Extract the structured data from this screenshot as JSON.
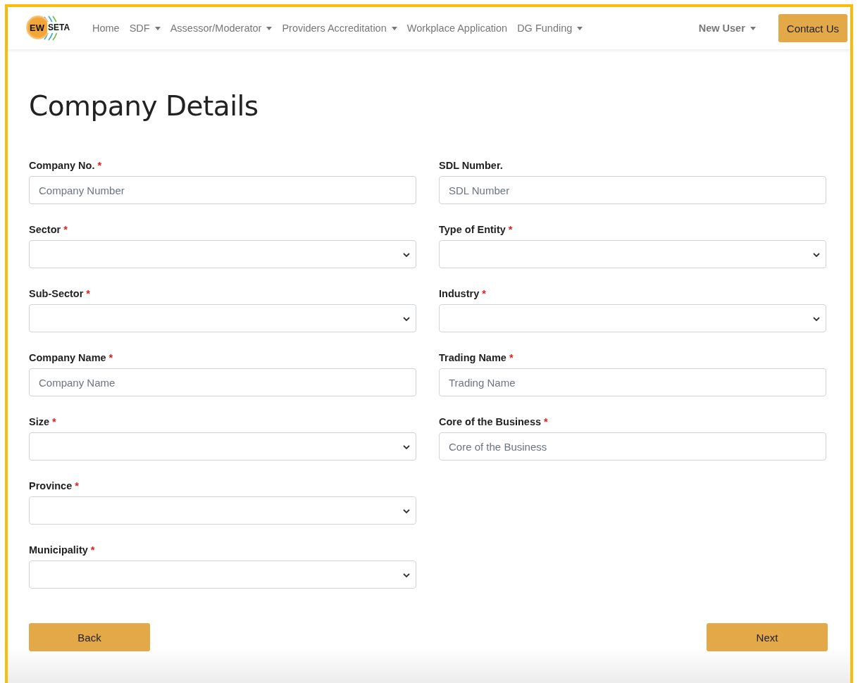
{
  "logo": {
    "left": "EW",
    "right": "SETA"
  },
  "nav": {
    "items": [
      {
        "label": "Home",
        "dropdown": false
      },
      {
        "label": "SDF",
        "dropdown": true
      },
      {
        "label": "Assessor/Moderator",
        "dropdown": true
      },
      {
        "label": "Providers Accreditation",
        "dropdown": true
      },
      {
        "label": "Workplace Application",
        "dropdown": false
      },
      {
        "label": "DG Funding",
        "dropdown": true
      }
    ],
    "user": {
      "label": "New User",
      "dropdown": true
    },
    "contact_button": "Contact Us"
  },
  "title": "Company Details",
  "columns": [
    [
      {
        "label": "Company No.",
        "required_mark": "*",
        "kind": "text",
        "placeholder": "Company Number"
      },
      {
        "label": "Sector",
        "required_mark": "*",
        "kind": "select"
      },
      {
        "label": "Sub-Sector",
        "required_mark": "*",
        "kind": "select"
      },
      {
        "label": "Company Name",
        "required_mark": "*",
        "kind": "text",
        "placeholder": "Company Name"
      },
      {
        "label": "Size",
        "required_mark": "*",
        "kind": "select"
      },
      {
        "label": "Province",
        "required_mark": "*",
        "kind": "select"
      },
      {
        "label": "Municipality",
        "required_mark": "*",
        "kind": "select"
      }
    ],
    [
      {
        "label": "SDL Number.",
        "kind": "text",
        "placeholder": "SDL Number"
      },
      {
        "label": "Type of Entity",
        "required_mark": "*",
        "kind": "select"
      },
      {
        "label": "Industry",
        "required_mark": "*",
        "kind": "select"
      },
      {
        "label": "Trading Name",
        "required_mark": "*",
        "kind": "text",
        "placeholder": "Trading Name"
      },
      {
        "label": "Core of the Business",
        "required_mark": "*",
        "kind": "text",
        "placeholder": "Core of the Business"
      }
    ]
  ],
  "buttons": {
    "back": "Back",
    "next": "Next"
  }
}
